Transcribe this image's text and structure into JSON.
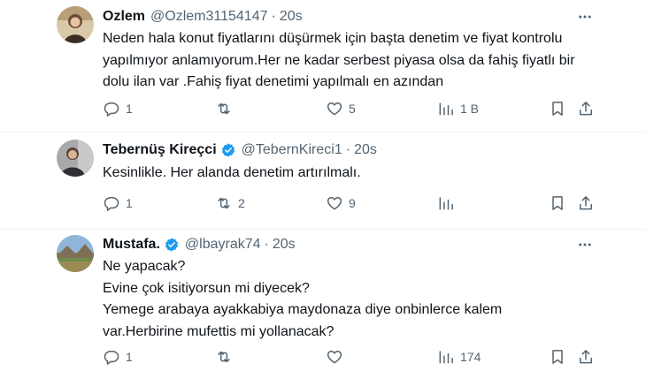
{
  "tweets": [
    {
      "name": "Ozlem",
      "handle": "@Ozlem31154147",
      "dot": "·",
      "time": "20s",
      "verified": false,
      "lines": [
        "Neden hala konut fiyatlarını düşürmek için başta denetim ve fiyat kontrolu",
        "yapılmıyor anlamıyorum.Her ne kadar serbest piyasa olsa da fahiş fiyatlı bir",
        "dolu ilan var .Fahiş fiyat denetimi yapılmalı en azından"
      ],
      "replies": "1",
      "retweets": "",
      "likes": "5",
      "views": "1 B"
    },
    {
      "name": "Tebernüş Kireçci",
      "handle": "@TebernKireci1",
      "dot": "·",
      "time": "20s",
      "verified": true,
      "lines": [
        "Kesinlikle. Her alanda denetim artırılmalı."
      ],
      "replies": "1",
      "retweets": "2",
      "likes": "9",
      "views": ""
    },
    {
      "name": "Mustafa.",
      "handle": "@lbayrak74",
      "dot": "·",
      "time": "20s",
      "verified": true,
      "lines": [
        "Ne yapacak?",
        "Evine çok isitiyorsun mi diyecek?",
        "Yemege arabaya ayakkabiya maydonaza diye onbinlerce kalem",
        "var.Herbirine mufettis mi yollanacak?"
      ],
      "replies": "1",
      "retweets": "",
      "likes": "",
      "views": "174"
    }
  ],
  "colors": {
    "text": "#0f1419",
    "secondary": "#536471",
    "verified_blue": "#1d9bf0",
    "divider": "#eff3f4"
  },
  "icons": [
    "reply-icon",
    "retweet-icon",
    "like-icon",
    "views-icon",
    "bookmark-icon",
    "share-icon",
    "more-icon",
    "verified-badge-icon"
  ]
}
